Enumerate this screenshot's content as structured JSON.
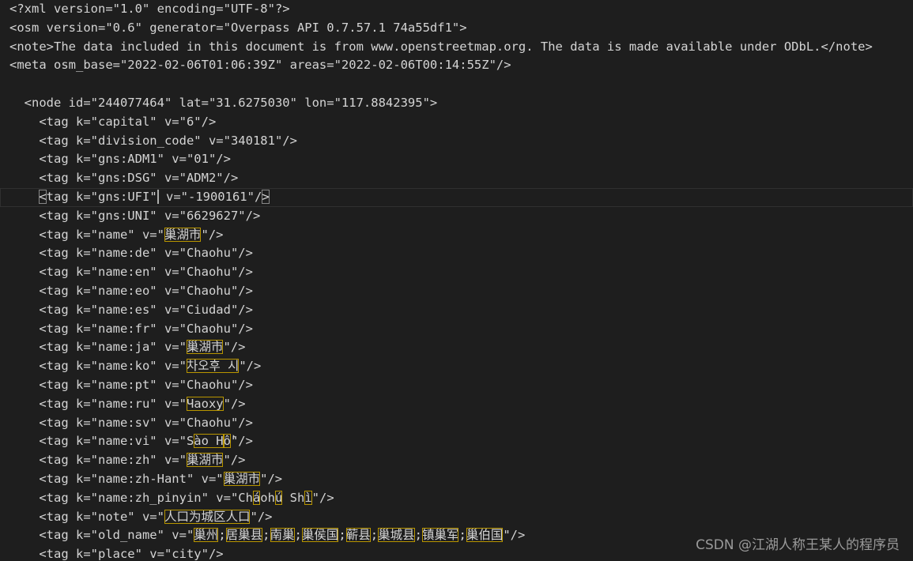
{
  "editor": {
    "lines": [
      [
        {
          "t": "<?xml version=\"1.0\" encoding=\"UTF-8\"?>"
        }
      ],
      [
        {
          "t": "<osm version=\"0.6\" generator=\"Overpass API 0.7.57.1 74a55df1\">"
        }
      ],
      [
        {
          "t": "<note>The data included in this document is from www.openstreetmap.org. The data is made available under ODbL.</note>"
        }
      ],
      [
        {
          "t": "<meta osm_base=\"2022-02-06T01:06:39Z\" areas=\"2022-02-06T00:14:55Z\"/>"
        }
      ],
      [
        {
          "t": ""
        }
      ],
      [
        {
          "t": "  <node id=\"244077464\" lat=\"31.6275030\" lon=\"117.8842395\">"
        }
      ],
      [
        {
          "t": "    <tag k=\"capital\" v=\"6\"/>"
        }
      ],
      [
        {
          "t": "    <tag k=\"division_code\" v=\"340181\"/>"
        }
      ],
      [
        {
          "t": "    <tag k=\"gns:ADM1\" v=\"01\"/>"
        }
      ],
      [
        {
          "t": "    <tag k=\"gns:DSG\" v=\"ADM2\"/>"
        }
      ],
      [
        {
          "t": "    "
        },
        {
          "t": "<",
          "m": "bracket"
        },
        {
          "t": "tag k=\"gns:UFI\""
        },
        {
          "t": "",
          "m": "cursor"
        },
        {
          "t": " v=\"-1900161\"/"
        },
        {
          "t": ">",
          "m": "bracket"
        }
      ],
      [
        {
          "t": "    <tag k=\"gns:UNI\" v=\"6629627\"/>"
        }
      ],
      [
        {
          "t": "    <tag k=\"name\" v=\""
        },
        {
          "t": "巢湖市",
          "m": "box"
        },
        {
          "t": "\"/>"
        }
      ],
      [
        {
          "t": "    <tag k=\"name:de\" v=\"Chaohu\"/>"
        }
      ],
      [
        {
          "t": "    <tag k=\"name:en\" v=\"Chaohu\"/>"
        }
      ],
      [
        {
          "t": "    <tag k=\"name:eo\" v=\"Chaohu\"/>"
        }
      ],
      [
        {
          "t": "    <tag k=\"name:es\" v=\"Ciudad\"/>"
        }
      ],
      [
        {
          "t": "    <tag k=\"name:fr\" v=\"Chaohu\"/>"
        }
      ],
      [
        {
          "t": "    <tag k=\"name:ja\" v=\""
        },
        {
          "t": "巢湖市",
          "m": "box"
        },
        {
          "t": "\"/>"
        }
      ],
      [
        {
          "t": "    <tag k=\"name:ko\" v=\""
        },
        {
          "t": "차오후 시",
          "m": "box"
        },
        {
          "t": "\"/>"
        }
      ],
      [
        {
          "t": "    <tag k=\"name:pt\" v=\"Chaohu\"/>"
        }
      ],
      [
        {
          "t": "    <tag k=\"name:ru\" v=\""
        },
        {
          "t": "Чаоху",
          "m": "box"
        },
        {
          "t": "\"/>"
        }
      ],
      [
        {
          "t": "    <tag k=\"name:sv\" v=\"Chaohu\"/>"
        }
      ],
      [
        {
          "t": "    <tag k=\"name:vi\" v=\"S"
        },
        {
          "t": "ào H",
          "m": "box"
        },
        {
          "t": "ồ",
          "m": "box"
        },
        {
          "t": "\"/>"
        }
      ],
      [
        {
          "t": "    <tag k=\"name:zh\" v=\""
        },
        {
          "t": "巢湖市",
          "m": "box"
        },
        {
          "t": "\"/>"
        }
      ],
      [
        {
          "t": "    <tag k=\"name:zh-Hant\" v=\""
        },
        {
          "t": "巢湖市",
          "m": "box"
        },
        {
          "t": "\"/>"
        }
      ],
      [
        {
          "t": "    <tag k=\"name:zh_pinyin\" v=\"Ch"
        },
        {
          "t": "á",
          "m": "box"
        },
        {
          "t": "oh"
        },
        {
          "t": "ú",
          "m": "box"
        },
        {
          "t": " Sh"
        },
        {
          "t": "ì",
          "m": "box"
        },
        {
          "t": "\"/>"
        }
      ],
      [
        {
          "t": "    <tag k=\"note\" v=\""
        },
        {
          "t": "人口为城区人口",
          "m": "box"
        },
        {
          "t": "\"/>"
        }
      ],
      [
        {
          "t": "    <tag k=\"old_name\" v=\""
        },
        {
          "t": "巢州",
          "m": "box"
        },
        {
          "t": ";"
        },
        {
          "t": "居巢县",
          "m": "box"
        },
        {
          "t": ";"
        },
        {
          "t": "南巢",
          "m": "box"
        },
        {
          "t": ";"
        },
        {
          "t": "巢侯国",
          "m": "box"
        },
        {
          "t": ";"
        },
        {
          "t": "蕲县",
          "m": "box"
        },
        {
          "t": ";"
        },
        {
          "t": "巢城县",
          "m": "box"
        },
        {
          "t": ";"
        },
        {
          "t": "镇巢军",
          "m": "box"
        },
        {
          "t": ";"
        },
        {
          "t": "巢伯国",
          "m": "box"
        },
        {
          "t": "\"/>"
        }
      ],
      [
        {
          "t": "    <tag k=\"place\" v=\"city\"/>"
        }
      ]
    ],
    "current_line_index": 10
  },
  "watermark": {
    "text": "CSDN @江湖人称王某人的程序员"
  },
  "colors": {
    "background": "#1e1e1e",
    "text": "#d4d4d4",
    "unicode_highlight_border": "#b89500",
    "bracket_match_border": "#888888",
    "current_line_border": "#303030",
    "watermark": "#9a9a9a"
  }
}
